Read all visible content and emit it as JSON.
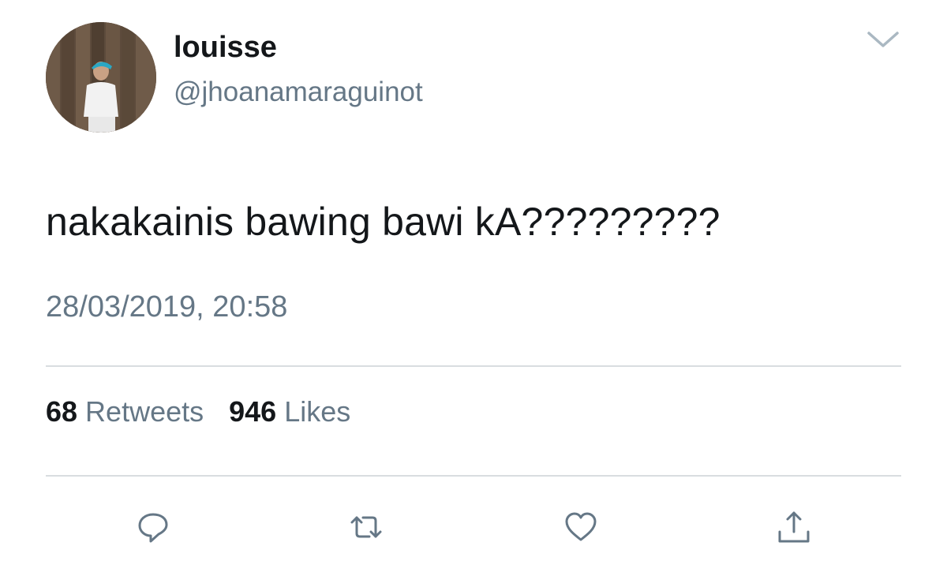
{
  "tweet": {
    "display_name": "louisse",
    "handle": "@jhoanamaraguinot",
    "text": "nakakainis bawing bawi kA?????????",
    "timestamp": "28/03/2019, 20:58",
    "retweets": {
      "count": "68",
      "label": "Retweets"
    },
    "likes": {
      "count": "946",
      "label": "Likes"
    }
  },
  "icons": {
    "menu": "chevron-down-icon",
    "reply": "reply-icon",
    "retweet": "retweet-icon",
    "like": "heart-icon",
    "share": "share-icon"
  },
  "colors": {
    "text_primary": "#14171a",
    "text_secondary": "#657786",
    "icon": "#657786",
    "divider": "#d9dde0"
  }
}
